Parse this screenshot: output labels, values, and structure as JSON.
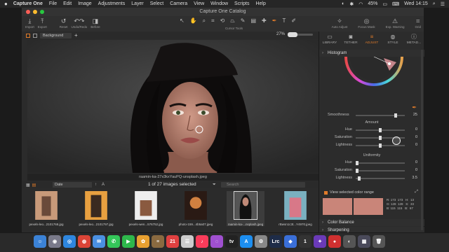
{
  "menubar": {
    "app_name": "Capture One",
    "items": [
      "File",
      "Edit",
      "Image",
      "Adjustments",
      "Layer",
      "Select",
      "Camera",
      "View",
      "Window",
      "Scripts",
      "Help"
    ],
    "battery": "45%",
    "clock": "Wed 14:15"
  },
  "window": {
    "title": "Capture One Catalog"
  },
  "toolbar": {
    "left_buttons": [
      {
        "icon": "import-icon",
        "label": "Import"
      },
      {
        "icon": "export-icon",
        "label": "Export"
      },
      {
        "icon": "reset-icon",
        "label": "Reset"
      },
      {
        "icon": "undo-redo-icon",
        "label": "Undo/Redo"
      },
      {
        "icon": "before-icon",
        "label": "Before"
      }
    ],
    "cursor_tools_label": "Cursor Tools",
    "right_buttons": [
      {
        "icon": "auto-adjust-icon",
        "label": "Auto Adjust"
      },
      {
        "icon": "focus-mask-icon",
        "label": "Focus Mask"
      },
      {
        "icon": "exp-warning-icon",
        "label": "Exp. Warning"
      },
      {
        "icon": "grid-icon",
        "label": "Grid"
      }
    ]
  },
  "viewer": {
    "background_select": "Background",
    "zoom": "27%",
    "caption": "raamin-ka-27x3kxYauPQ-unsplash.jpeg"
  },
  "browser": {
    "sort": "Date",
    "count": "1 of 27 images selected",
    "search_placeholder": "Search",
    "thumbnails": [
      {
        "label": "pexels-leo...2101768.jpg",
        "colors": [
          "#c89a7a",
          "#6a4a3a"
        ]
      },
      {
        "label": "pexels-leo...2101797.jpg",
        "colors": [
          "#e8a040",
          "#3a2a20"
        ]
      },
      {
        "label": "pexels-wen...576752.jpg",
        "colors": [
          "#eeeeee",
          "#8a5a40"
        ]
      },
      {
        "label": "photo-159...4b5a07.jpeg",
        "colors": [
          "#d08040",
          "#2a1a14"
        ]
      },
      {
        "label": "raamin-ka-...nsplash.jpeg",
        "colors": [
          "#555555",
          "#111111"
        ]
      },
      {
        "label": "rBwsn1c3t...Y4970.jpeg",
        "colors": [
          "#d87888",
          "#7ab0c0"
        ]
      }
    ]
  },
  "panel": {
    "tabs": [
      {
        "icon": "library-icon",
        "label": "LIBRARY"
      },
      {
        "icon": "tether-icon",
        "label": "TETHER"
      },
      {
        "icon": "adjust-icon",
        "label": "ADJUST"
      },
      {
        "icon": "style-icon",
        "label": "STYLE"
      },
      {
        "icon": "metadata-icon",
        "label": "METAD..."
      }
    ],
    "histogram_title": "Histogram",
    "smoothness": {
      "label": "Smoothness",
      "value": "25",
      "level": 0.8
    },
    "amount_title": "Amount",
    "amount_rows": [
      {
        "label": "Hue",
        "value": "0",
        "level": 0.5
      },
      {
        "label": "Saturation",
        "value": "0",
        "level": 0.5
      },
      {
        "label": "Lightness",
        "value": "0",
        "level": 0.5
      }
    ],
    "uniformity_title": "Uniformity",
    "uniformity_rows": [
      {
        "label": "Hue",
        "value": "0",
        "level": 0.0
      },
      {
        "label": "Saturation",
        "value": "0",
        "level": 0.0
      },
      {
        "label": "Lightness",
        "value": "3.5",
        "level": 0.05
      }
    ],
    "view_range_label": "View selected color range",
    "swatch_color": "#c98579",
    "rgb_readout": "R: 173  173   H:  13\nG: 128  128   S:  33\nB: 115  115   B:  67",
    "bottom_sections": [
      "Color Balance",
      "Sharpening",
      "Noise Reduction"
    ]
  },
  "dock": {
    "icons": [
      {
        "name": "finder-icon",
        "glyph": "☺",
        "color": "#3b82d6"
      },
      {
        "name": "launchpad-icon",
        "glyph": "◉",
        "color": "#7a7a8a"
      },
      {
        "name": "safari-icon",
        "glyph": "◎",
        "color": "#2e86de"
      },
      {
        "name": "chrome-icon",
        "glyph": "◍",
        "color": "#db4437"
      },
      {
        "name": "mail-icon",
        "glyph": "✉",
        "color": "#4a90e2"
      },
      {
        "name": "messages-icon",
        "glyph": "✆",
        "color": "#34c759"
      },
      {
        "name": "facetime-icon",
        "glyph": "▶",
        "color": "#2eb84b"
      },
      {
        "name": "photos-icon",
        "glyph": "✿",
        "color": "#e8a030"
      },
      {
        "name": "notes-icon",
        "glyph": "≡",
        "color": "#8a6a40"
      },
      {
        "name": "calendar-icon",
        "glyph": "21",
        "color": "#e04040"
      },
      {
        "name": "reminders-icon",
        "glyph": "☰",
        "color": "#cccccc"
      },
      {
        "name": "music-icon",
        "glyph": "♪",
        "color": "#fa3c5a"
      },
      {
        "name": "podcasts-icon",
        "glyph": "◌",
        "color": "#a050d0"
      },
      {
        "name": "tv-icon",
        "glyph": "tv",
        "color": "#222222"
      },
      {
        "name": "app-store-icon",
        "glyph": "A",
        "color": "#1c8ef0"
      },
      {
        "name": "settings-icon",
        "glyph": "⚙",
        "color": "#888888"
      },
      {
        "name": "lightroom-classic-icon",
        "glyph": "Lrc",
        "color": "#1e2c48"
      },
      {
        "name": "photoshop-icon",
        "glyph": "◆",
        "color": "#3a6fd8"
      },
      {
        "name": "capture-one-icon",
        "glyph": "1",
        "color": "#333333"
      },
      {
        "name": "app-icon",
        "glyph": "✦",
        "color": "#6a3ab8"
      },
      {
        "name": "screen-recorder-icon",
        "glyph": "●",
        "color": "#d03030"
      },
      {
        "name": "app-icon-2",
        "glyph": "◐",
        "color": "#555555"
      },
      {
        "name": "downloads-icon",
        "glyph": "▦",
        "color": "#4a4a5a"
      },
      {
        "name": "trash-icon",
        "glyph": "🗑",
        "color": "#555555"
      }
    ]
  }
}
